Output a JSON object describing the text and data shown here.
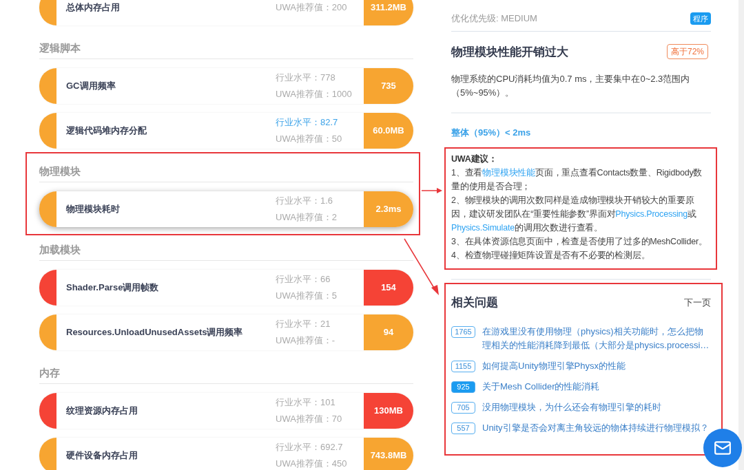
{
  "sections": [
    {
      "rows": [
        {
          "label": "总体内存占用",
          "recommend": "UWA推荐值：200",
          "value": "311.2MB",
          "color": "#f7a531",
          "selected": false
        }
      ]
    },
    {
      "title": "逻辑脚本",
      "rows": [
        {
          "label": "GC调用频率",
          "industry": "行业水平：778",
          "industry_highlight": false,
          "recommend": "UWA推荐值：1000",
          "value": "735",
          "color": "#f7a531",
          "selected": false
        },
        {
          "label": "逻辑代码堆内存分配",
          "industry": "行业水平：82.7",
          "industry_highlight": true,
          "recommend": "UWA推荐值：50",
          "value": "60.0MB",
          "color": "#f7a531",
          "selected": false
        }
      ]
    },
    {
      "title": "物理模块",
      "rows": [
        {
          "label": "物理模块耗时",
          "industry": "行业水平：1.6",
          "industry_highlight": false,
          "recommend": "UWA推荐值：2",
          "value": "2.3ms",
          "color": "#f7a531",
          "selected": true
        }
      ]
    },
    {
      "title": "加载模块",
      "rows": [
        {
          "label": "Shader.Parse调用帧数",
          "industry": "行业水平：66",
          "industry_highlight": false,
          "recommend": "UWA推荐值：5",
          "value": "154",
          "color": "#f54336",
          "selected": false
        },
        {
          "label": "Resources.UnloadUnusedAssets调用频率",
          "industry": "行业水平：21",
          "industry_highlight": false,
          "recommend": "UWA推荐值：-",
          "value": "94",
          "color": "#f7a531",
          "selected": false
        }
      ]
    },
    {
      "title": "内存",
      "rows": [
        {
          "label": "纹理资源内存占用",
          "industry": "行业水平：101",
          "industry_highlight": false,
          "recommend": "UWA推荐值：70",
          "value": "130MB",
          "color": "#f54336",
          "selected": false
        },
        {
          "label": "硬件设备内存占用",
          "industry": "行业水平：692.7",
          "industry_highlight": false,
          "recommend": "UWA推荐值：450",
          "value": "743.8MB",
          "color": "#f7a531",
          "selected": false
        }
      ]
    }
  ],
  "detail": {
    "priority": "优化优先级: MEDIUM",
    "tag": "程序",
    "title": "物理模块性能开销过大",
    "badge": "高于72%",
    "description": "物理系统的CPU消耗均值为0.7 ms，主要集中在0~2.3范围内（5%~95%）。",
    "overall": "整体（95%）< 2ms"
  },
  "advice": {
    "heading": "UWA建议：",
    "items": [
      [
        {
          "kind": "text",
          "text": "1、查看"
        },
        {
          "kind": "link",
          "text": "物理模块性能"
        },
        {
          "kind": "text",
          "text": "页面，重点查看Contacts数量、Rigidbody数量的使用是否合理；"
        }
      ],
      [
        {
          "kind": "text",
          "text": "2、物理模块的调用次数同样是造成物理模块开销较大的重要原因，建议研发团队在“重要性能参数”界面对"
        },
        {
          "kind": "link",
          "text": "Physics.Processing"
        },
        {
          "kind": "text",
          "text": "或"
        },
        {
          "kind": "link",
          "text": "Physics.Simulate"
        },
        {
          "kind": "text",
          "text": "的调用次数进行查看。"
        }
      ],
      [
        {
          "kind": "text",
          "text": "3、在具体资源信息页面中，检查是否使用了过多的MeshCollider。"
        }
      ],
      [
        {
          "kind": "text",
          "text": "4、检查物理碰撞矩阵设置是否有不必要的检测层。"
        }
      ]
    ]
  },
  "related": {
    "title": "相关问题",
    "next": "下一页",
    "items": [
      {
        "count": "1765",
        "text": "在游戏里没有使用物理（physics)相关功能时，怎么把物理相关的性能消耗降到最低（大部分是physics.processi…",
        "selected": false
      },
      {
        "count": "1155",
        "text": "如何提高Unity物理引擎Physx的性能",
        "selected": false
      },
      {
        "count": "925",
        "text": "关于Mesh Collider的性能消耗",
        "selected": true
      },
      {
        "count": "705",
        "text": "没用物理模块，为什么还会有物理引擎的耗时",
        "selected": false
      },
      {
        "count": "557",
        "text": "Unity引擎是否会对离主角较远的物体持续进行物理模拟？",
        "selected": false
      }
    ]
  }
}
